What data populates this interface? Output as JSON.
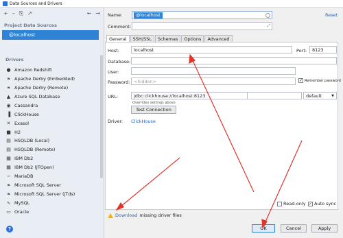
{
  "window": {
    "title": "Data Sources and Drivers"
  },
  "left": {
    "toolbar": [
      "+",
      "–",
      "⎘",
      "↗",
      "←",
      "→"
    ],
    "project_title": "Project Data Sources",
    "selected_source": "@localhost",
    "drivers_title": "Drivers",
    "drivers": [
      {
        "label": "Amazon Redshift",
        "icon": "drop-icon",
        "glyph": "●"
      },
      {
        "label": "Apache Derby (Embedded)",
        "icon": "feather-icon",
        "glyph": "❧"
      },
      {
        "label": "Apache Derby (Remote)",
        "icon": "feather-icon",
        "glyph": "❧"
      },
      {
        "label": "Azure SQL Database",
        "icon": "azure-icon",
        "glyph": "▲"
      },
      {
        "label": "Cassandra",
        "icon": "eye-icon",
        "glyph": "◉"
      },
      {
        "label": "ClickHouse",
        "icon": "bars-icon",
        "glyph": "▐"
      },
      {
        "label": "Exasol",
        "icon": "x-icon",
        "glyph": "✕"
      },
      {
        "label": "H2",
        "icon": "h2-icon",
        "glyph": "■"
      },
      {
        "label": "HSQLDB (Local)",
        "icon": "database-icon",
        "glyph": "▤"
      },
      {
        "label": "HSQLDB (Remote)",
        "icon": "database-icon",
        "glyph": "▤"
      },
      {
        "label": "IBM Db2",
        "icon": "ibm-icon",
        "glyph": "▦"
      },
      {
        "label": "IBM Db2 (JTOpen)",
        "icon": "ibm-icon",
        "glyph": "▦"
      },
      {
        "label": "MariaDB",
        "icon": "seal-icon",
        "glyph": "∽"
      },
      {
        "label": "Microsoft SQL Server",
        "icon": "sqlserver-icon",
        "glyph": "❧"
      },
      {
        "label": "Microsoft SQL Server (jTds)",
        "icon": "sqlserver-icon",
        "glyph": "❧"
      },
      {
        "label": "MySQL",
        "icon": "dolphin-icon",
        "glyph": "∿"
      },
      {
        "label": "Oracle",
        "icon": "oracle-icon",
        "glyph": "▭"
      }
    ]
  },
  "form": {
    "name_label": "Name:",
    "name_value": "@localhost",
    "reset_label": "Reset",
    "comment_label": "Comment:",
    "tabs": [
      "General",
      "SSH/SSL",
      "Schemas",
      "Options",
      "Advanced"
    ],
    "host_label": "Host:",
    "host_value": "localhost",
    "port_label": "Port:",
    "port_value": "8123",
    "database_label": "Database:",
    "user_label": "User:",
    "password_label": "Password:",
    "password_placeholder": "<hidden>",
    "remember_label": "Remember password",
    "url_label": "URL:",
    "url_value": "jdbc:clickhouse://localhost:8123",
    "url_mode": "default",
    "overrides_note": "Overrides settings above",
    "test_button": "Test Connection",
    "driver_label": "Driver:",
    "driver_value": "ClickHouse"
  },
  "footer": {
    "download_link": "Download",
    "missing_text": "missing driver files",
    "read_only_label": "Read-only",
    "auto_sync_label": "Auto sync",
    "ok_button": "OK",
    "cancel_button": "Cancel",
    "apply_button": "Apply"
  },
  "colors": {
    "selection": "#2f83d6",
    "link": "#2a63b8",
    "arrow": "#e0342a"
  }
}
